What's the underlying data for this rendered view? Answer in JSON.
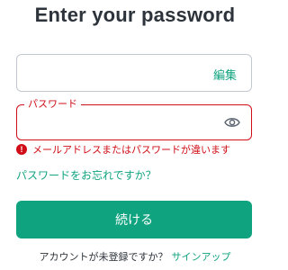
{
  "page": {
    "title": "Enter your password"
  },
  "email_field": {
    "value": "",
    "edit_label": "編集"
  },
  "password_field": {
    "label": "パスワード",
    "value": "",
    "toggle_icon": "eye-icon"
  },
  "error": {
    "icon": "error-icon",
    "icon_glyph": "!",
    "message": "メールアドレスまたはパスワードが違います"
  },
  "forgot_password": {
    "label": "パスワードをお忘れですか？"
  },
  "continue_button": {
    "label": "続ける"
  },
  "signup": {
    "prompt": "アカウントが未登録ですか？",
    "link": "サインアップ"
  },
  "colors": {
    "accent": "#10a37f",
    "error": "#d00e17",
    "text": "#2d333a",
    "border": "#c2c8d0"
  }
}
